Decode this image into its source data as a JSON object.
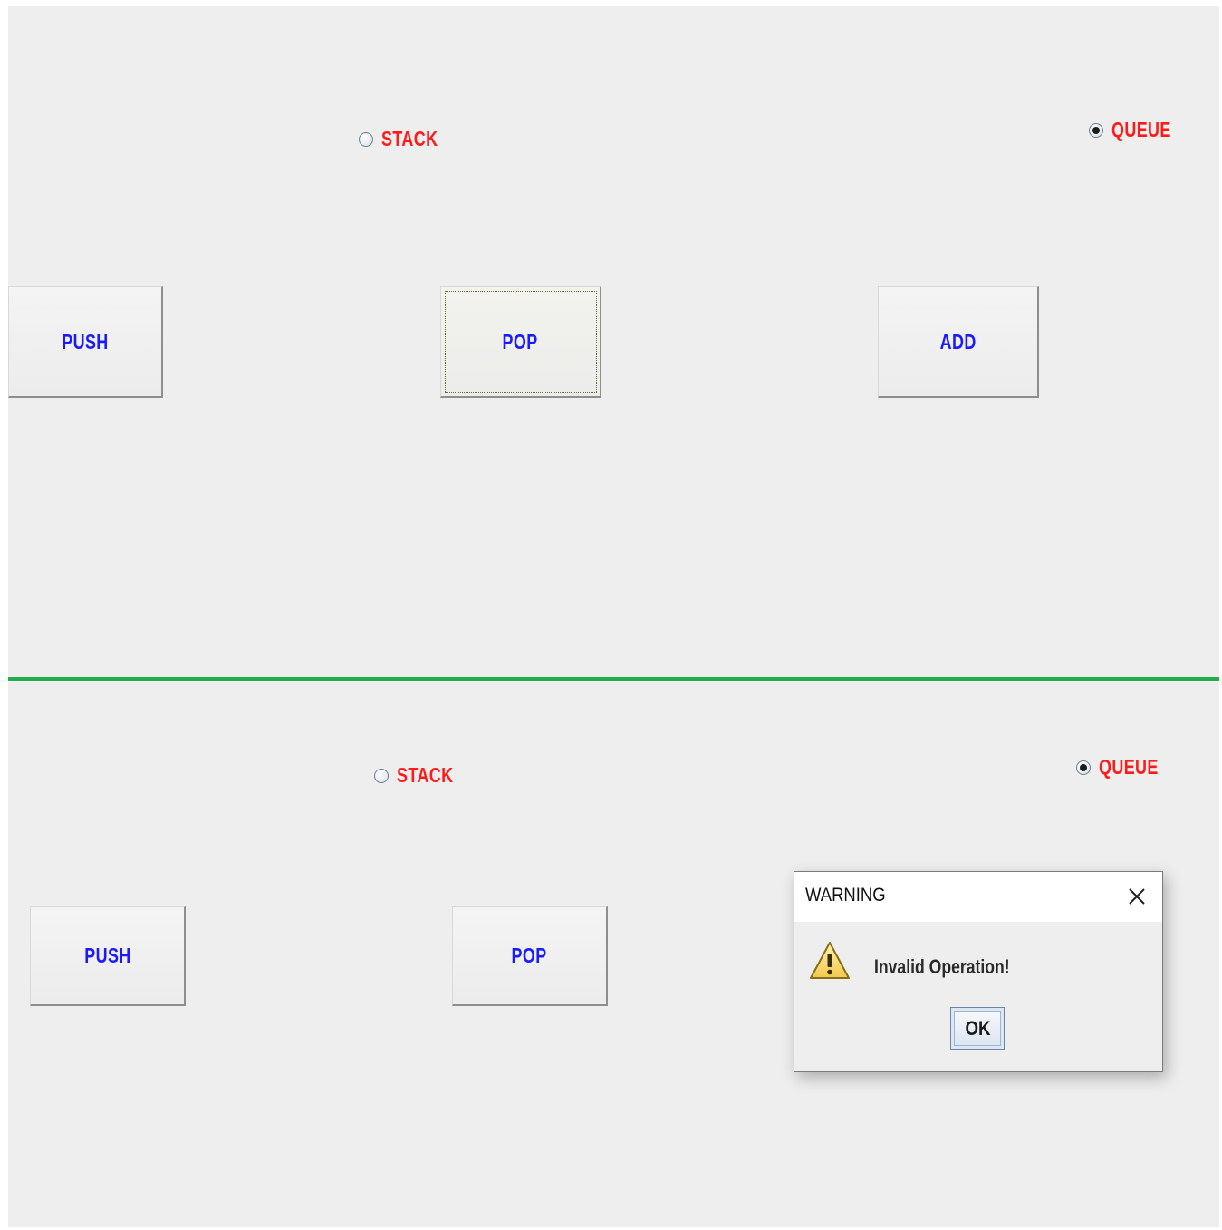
{
  "top_panel": {
    "radio_stack": {
      "label": "STACK",
      "checked": false
    },
    "radio_queue": {
      "label": "QUEUE",
      "checked": true
    },
    "buttons": {
      "push": "PUSH",
      "pop": "POP",
      "add": "ADD"
    }
  },
  "bottom_panel": {
    "radio_stack": {
      "label": "STACK",
      "checked": false
    },
    "radio_queue": {
      "label": "QUEUE",
      "checked": true
    },
    "buttons": {
      "push": "PUSH",
      "pop": "POP"
    }
  },
  "dialog": {
    "title": "WARNING",
    "message": "Invalid Operation!",
    "ok_label": "OK",
    "icon": "warning-icon",
    "close_icon": "close-icon"
  },
  "colors": {
    "panel_bg": "#eeeeee",
    "divider": "#1fae4a",
    "radio_label": "#ff1a1a",
    "button_label": "#1a1aff"
  }
}
